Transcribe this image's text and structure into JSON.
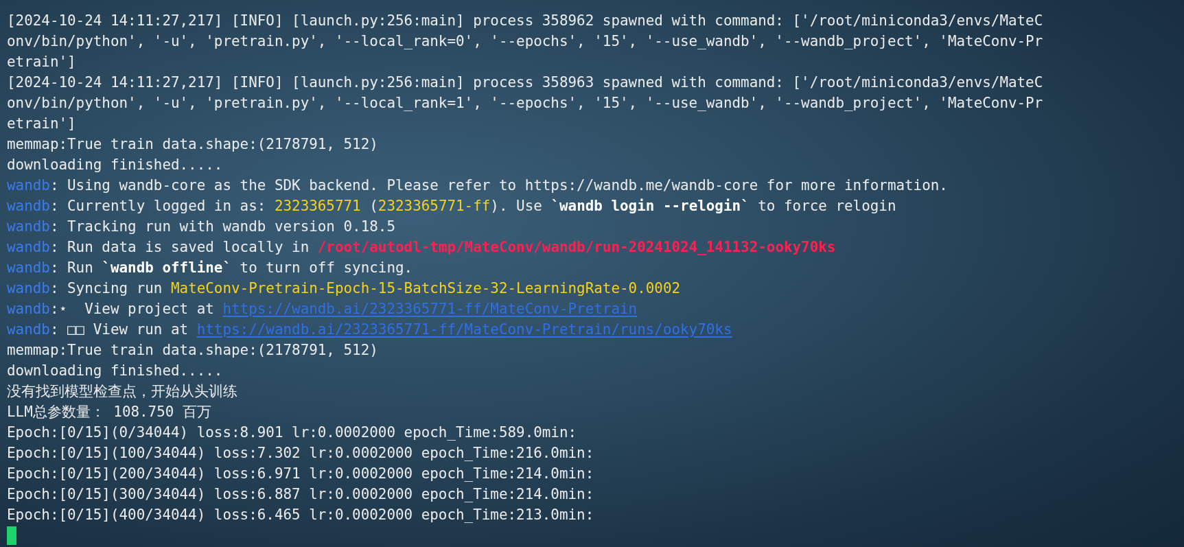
{
  "terminal": {
    "lines": [
      {
        "segments": [
          {
            "kind": "plain",
            "text": "[2024-10-24 14:11:27,217] [INFO] [launch.py:256:main] process 358962 spawned with command: ['/root/miniconda3/envs/MateC"
          }
        ]
      },
      {
        "segments": [
          {
            "kind": "plain",
            "text": "onv/bin/python', '-u', 'pretrain.py', '--local_rank=0', '--epochs', '15', '--use_wandb', '--wandb_project', 'MateConv-Pr"
          }
        ]
      },
      {
        "segments": [
          {
            "kind": "plain",
            "text": "etrain']"
          }
        ]
      },
      {
        "segments": [
          {
            "kind": "plain",
            "text": "[2024-10-24 14:11:27,217] [INFO] [launch.py:256:main] process 358963 spawned with command: ['/root/miniconda3/envs/MateC"
          }
        ]
      },
      {
        "segments": [
          {
            "kind": "plain",
            "text": "onv/bin/python', '-u', 'pretrain.py', '--local_rank=1', '--epochs', '15', '--use_wandb', '--wandb_project', 'MateConv-Pr"
          }
        ]
      },
      {
        "segments": [
          {
            "kind": "plain",
            "text": "etrain']"
          }
        ]
      },
      {
        "segments": [
          {
            "kind": "plain",
            "text": "memmap:True train data.shape:(2178791, 512)"
          }
        ]
      },
      {
        "segments": [
          {
            "kind": "plain",
            "text": "downloading finished....."
          }
        ]
      },
      {
        "segments": [
          {
            "kind": "prefix",
            "text": "wandb"
          },
          {
            "kind": "plain",
            "text": ": Using wandb-core as the SDK backend. Please refer to https://wandb.me/wandb-core for more information."
          }
        ]
      },
      {
        "segments": [
          {
            "kind": "prefix",
            "text": "wandb"
          },
          {
            "kind": "plain",
            "text": ": Currently logged in as: "
          },
          {
            "kind": "highlight",
            "text": "2323365771"
          },
          {
            "kind": "plain",
            "text": " ("
          },
          {
            "kind": "highlight",
            "text": "2323365771-ff"
          },
          {
            "kind": "plain",
            "text": "). Use "
          },
          {
            "kind": "command",
            "text": "`wandb login --relogin`"
          },
          {
            "kind": "plain",
            "text": " to force relogin"
          }
        ]
      },
      {
        "segments": [
          {
            "kind": "prefix",
            "text": "wandb"
          },
          {
            "kind": "plain",
            "text": ": Tracking run with wandb version 0.18.5"
          }
        ]
      },
      {
        "segments": [
          {
            "kind": "prefix",
            "text": "wandb"
          },
          {
            "kind": "plain",
            "text": ": Run data is saved locally in "
          },
          {
            "kind": "path",
            "text": "/root/autodl-tmp/MateConv/wandb/run-20241024_141132-ooky70ks"
          }
        ]
      },
      {
        "segments": [
          {
            "kind": "prefix",
            "text": "wandb"
          },
          {
            "kind": "plain",
            "text": ": Run "
          },
          {
            "kind": "command",
            "text": "`wandb offline`"
          },
          {
            "kind": "plain",
            "text": " to turn off syncing."
          }
        ]
      },
      {
        "segments": [
          {
            "kind": "prefix",
            "text": "wandb"
          },
          {
            "kind": "plain",
            "text": ": Syncing run "
          },
          {
            "kind": "highlight",
            "text": "MateConv-Pretrain-Epoch-15-BatchSize-32-LearningRate-0.0002"
          }
        ]
      },
      {
        "segments": [
          {
            "kind": "prefix",
            "text": "wandb"
          },
          {
            "kind": "plain",
            "text": ":⋆  View project at "
          },
          {
            "kind": "link",
            "text": "https://wandb.ai/2323365771-ff/MateConv-Pretrain"
          }
        ]
      },
      {
        "segments": [
          {
            "kind": "prefix",
            "text": "wandb"
          },
          {
            "kind": "plain",
            "text": ": □□ View run at "
          },
          {
            "kind": "link",
            "text": "https://wandb.ai/2323365771-ff/MateConv-Pretrain/runs/ooky70ks"
          }
        ]
      },
      {
        "segments": [
          {
            "kind": "plain",
            "text": "memmap:True train data.shape:(2178791, 512)"
          }
        ]
      },
      {
        "segments": [
          {
            "kind": "plain",
            "text": "downloading finished....."
          }
        ]
      },
      {
        "segments": [
          {
            "kind": "plain",
            "text": "没有找到模型检查点，开始从头训练"
          }
        ]
      },
      {
        "segments": [
          {
            "kind": "plain",
            "text": "LLM总参数量： 108.750 百万"
          }
        ]
      },
      {
        "segments": [
          {
            "kind": "plain",
            "text": "Epoch:[0/15](0/34044) loss:8.901 lr:0.0002000 epoch_Time:589.0min:"
          }
        ]
      },
      {
        "segments": [
          {
            "kind": "plain",
            "text": "Epoch:[0/15](100/34044) loss:7.302 lr:0.0002000 epoch_Time:216.0min:"
          }
        ]
      },
      {
        "segments": [
          {
            "kind": "plain",
            "text": "Epoch:[0/15](200/34044) loss:6.971 lr:0.0002000 epoch_Time:214.0min:"
          }
        ]
      },
      {
        "segments": [
          {
            "kind": "plain",
            "text": "Epoch:[0/15](300/34044) loss:6.887 lr:0.0002000 epoch_Time:214.0min:"
          }
        ]
      },
      {
        "segments": [
          {
            "kind": "plain",
            "text": "Epoch:[0/15](400/34044) loss:6.465 lr:0.0002000 epoch_Time:213.0min:"
          }
        ]
      }
    ]
  }
}
